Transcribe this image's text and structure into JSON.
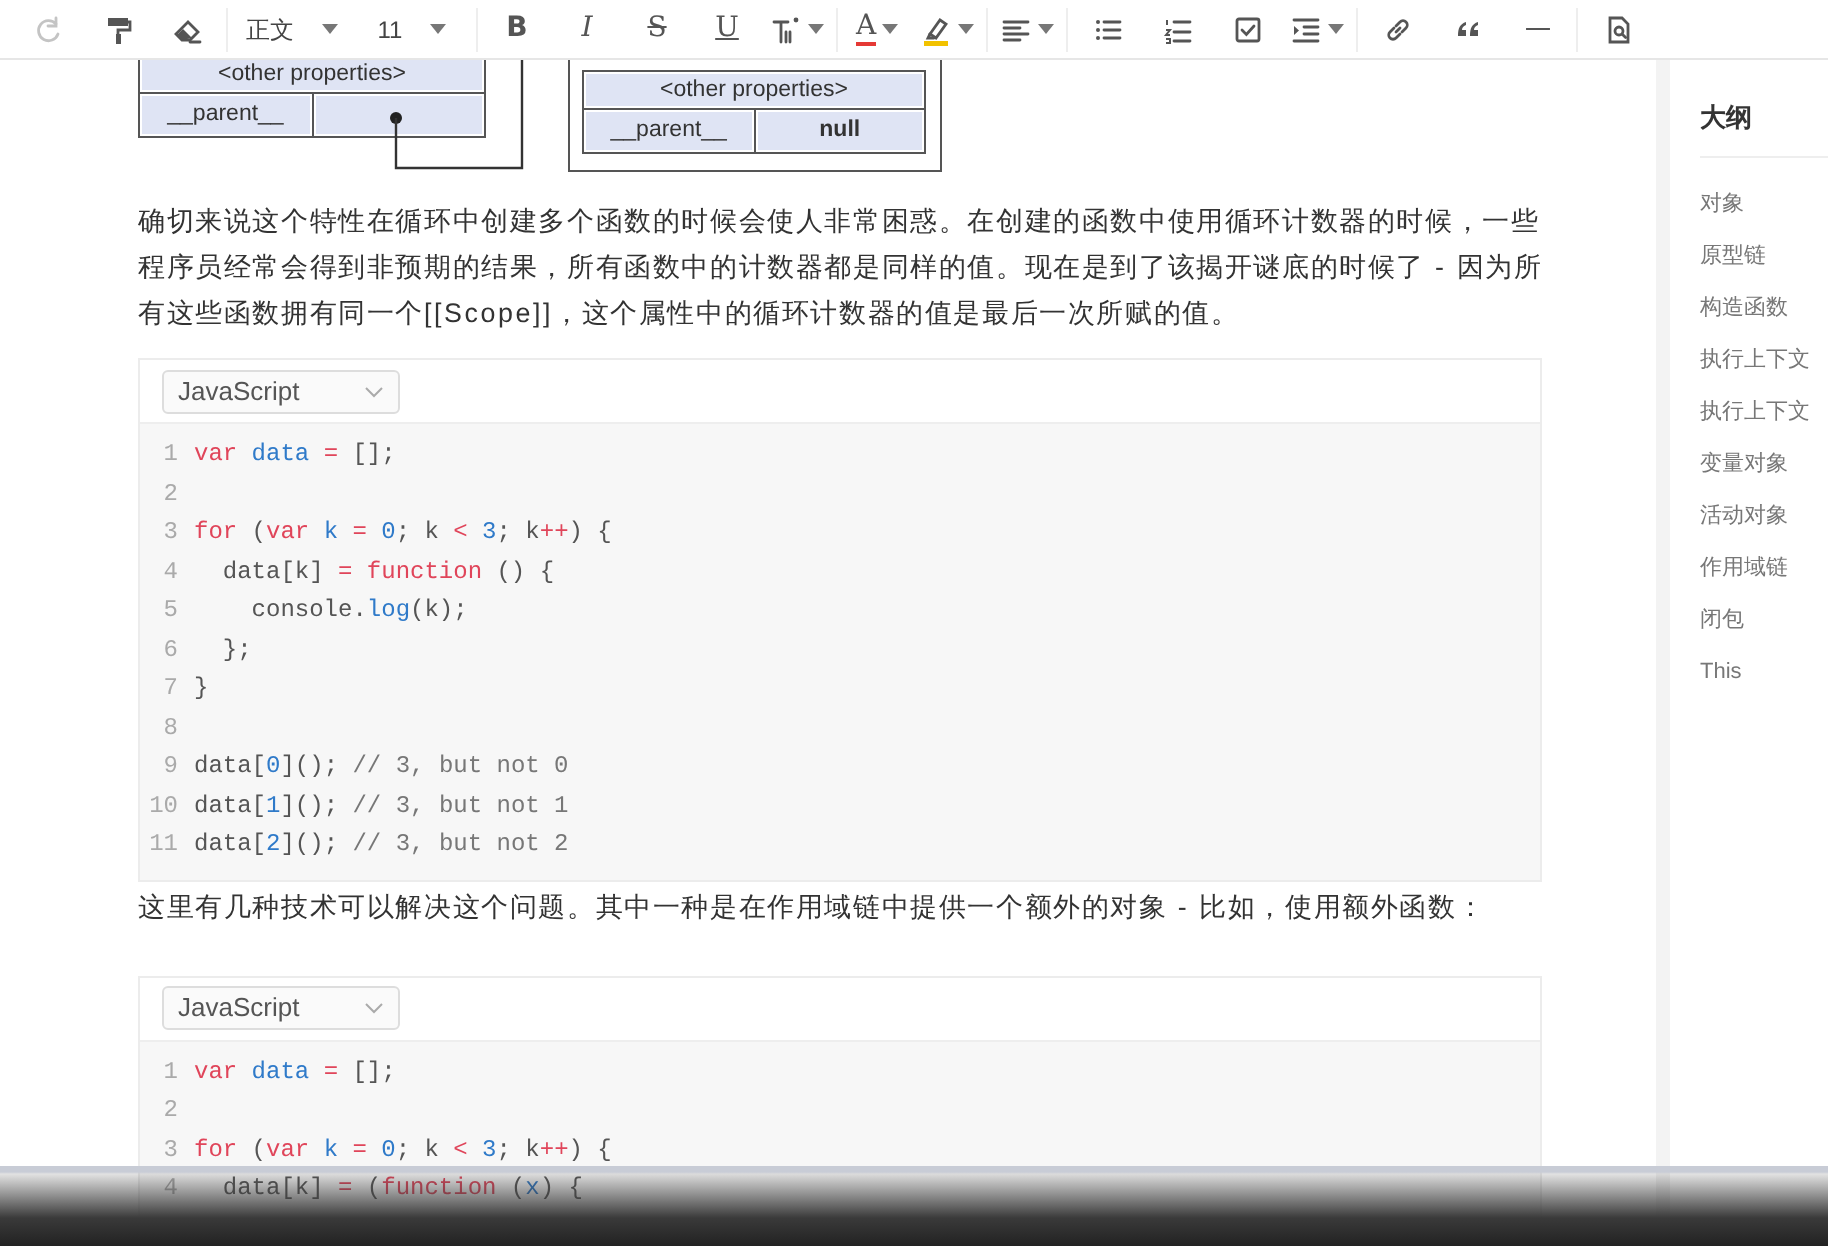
{
  "toolbar": {
    "redo": {
      "disabled": true
    },
    "selects": [
      "正文",
      "11"
    ],
    "format_letters": [
      "B",
      "I",
      "S",
      "U"
    ],
    "color_letter": "A"
  },
  "diagram": {
    "objects": [
      {
        "kind": "pointer",
        "properties_label": "<other properties>",
        "parent_label": "__parent__"
      },
      {
        "kind": "value",
        "properties_label": "<other properties>",
        "parent_label": "__parent__",
        "parent_value": "null"
      }
    ]
  },
  "content": [
    {
      "kind": "paragraph",
      "text": "确切来说这个特性在循环中创建多个函数的时候会使人非常困惑。在创建的函数中使用循环计数器的时候，一些程序员经常会得到非预期的结果，所有函数中的计数器都是同样的值。现在是到了该揭开谜底的时候了 - 因为所有这些函数拥有同一个[[Scope]]，这个属性中的循环计数器的值是最后一次所赋的值。"
    },
    {
      "kind": "code",
      "language": "JavaScript",
      "lines": [
        {
          "number": "1",
          "tokens": [
            {
              "t": "var",
              "kind": "keyword"
            },
            {
              "t": " data",
              "kind": "name"
            },
            {
              "t": " =",
              "kind": "operator"
            },
            {
              "t": " [];",
              "kind": "plain"
            }
          ]
        },
        {
          "number": "2"
        },
        {
          "number": "3",
          "tokens": [
            {
              "t": "for",
              "kind": "keyword"
            },
            {
              "t": " (",
              "kind": "plain"
            },
            {
              "t": "var",
              "kind": "keyword"
            },
            {
              "t": " k",
              "kind": "name"
            },
            {
              "t": " =",
              "kind": "operator"
            },
            {
              "t": " 0",
              "kind": "number"
            },
            {
              "t": "; k",
              "kind": "plain"
            },
            {
              "t": " <",
              "kind": "operator"
            },
            {
              "t": " 3",
              "kind": "number"
            },
            {
              "t": "; k",
              "kind": "plain"
            },
            {
              "t": "++",
              "kind": "operator"
            },
            {
              "t": ") {",
              "kind": "plain"
            }
          ]
        },
        {
          "number": "4",
          "tokens": [
            {
              "t": "  data[k]",
              "kind": "plain"
            },
            {
              "t": " =",
              "kind": "operator"
            },
            {
              "t": " function",
              "kind": "keyword"
            },
            {
              "t": " () {",
              "kind": "plain"
            }
          ]
        },
        {
          "number": "5",
          "tokens": [
            {
              "t": "    console.",
              "kind": "plain"
            },
            {
              "t": "log",
              "kind": "name"
            },
            {
              "t": "(k);",
              "kind": "plain"
            }
          ]
        },
        {
          "number": "6",
          "tokens": [
            {
              "t": "  };",
              "kind": "plain"
            }
          ]
        },
        {
          "number": "7",
          "tokens": [
            {
              "t": "}",
              "kind": "plain"
            }
          ]
        },
        {
          "number": "8"
        },
        {
          "number": "9",
          "tokens": [
            {
              "t": "data[",
              "kind": "plain"
            },
            {
              "t": "0",
              "kind": "number"
            },
            {
              "t": "]();",
              "kind": "plain"
            },
            {
              "t": " // 3, but not 0",
              "kind": "comment"
            }
          ]
        },
        {
          "number": "10",
          "tokens": [
            {
              "t": "data[",
              "kind": "plain"
            },
            {
              "t": "1",
              "kind": "number"
            },
            {
              "t": "]();",
              "kind": "plain"
            },
            {
              "t": " // 3, but not 1",
              "kind": "comment"
            }
          ]
        },
        {
          "number": "11",
          "tokens": [
            {
              "t": "data[",
              "kind": "plain"
            },
            {
              "t": "2",
              "kind": "number"
            },
            {
              "t": "]();",
              "kind": "plain"
            },
            {
              "t": " // 3, but not 2",
              "kind": "comment"
            }
          ]
        }
      ]
    },
    {
      "kind": "paragraph",
      "text": "这里有几种技术可以解决这个问题。其中一种是在作用域链中提供一个额外的对象 - 比如，使用额外函数："
    },
    {
      "kind": "code",
      "language": "JavaScript",
      "lines": [
        {
          "number": "1",
          "tokens": [
            {
              "t": "var",
              "kind": "keyword"
            },
            {
              "t": " data",
              "kind": "name"
            },
            {
              "t": " =",
              "kind": "operator"
            },
            {
              "t": " [];",
              "kind": "plain"
            }
          ]
        },
        {
          "number": "2"
        },
        {
          "number": "3",
          "tokens": [
            {
              "t": "for",
              "kind": "keyword"
            },
            {
              "t": " (",
              "kind": "plain"
            },
            {
              "t": "var",
              "kind": "keyword"
            },
            {
              "t": " k",
              "kind": "name"
            },
            {
              "t": " =",
              "kind": "operator"
            },
            {
              "t": " 0",
              "kind": "number"
            },
            {
              "t": "; k",
              "kind": "plain"
            },
            {
              "t": " <",
              "kind": "operator"
            },
            {
              "t": " 3",
              "kind": "number"
            },
            {
              "t": "; k",
              "kind": "plain"
            },
            {
              "t": "++",
              "kind": "operator"
            },
            {
              "t": ") {",
              "kind": "plain"
            }
          ]
        },
        {
          "number": "4",
          "tokens": [
            {
              "t": "  data[k]",
              "kind": "plain"
            },
            {
              "t": " =",
              "kind": "operator"
            },
            {
              "t": " (",
              "kind": "plain"
            },
            {
              "t": "function",
              "kind": "keyword"
            },
            {
              "t": " (",
              "kind": "plain"
            },
            {
              "t": "x",
              "kind": "name"
            },
            {
              "t": ") {",
              "kind": "plain"
            }
          ]
        }
      ]
    }
  ],
  "outline": {
    "title": "大纲",
    "items": [
      {
        "label": "对象"
      },
      {
        "label": "原型链"
      },
      {
        "label": "构造函数"
      },
      {
        "label": "执行上下文"
      },
      {
        "label": "执行上下文"
      },
      {
        "label": "变量对象"
      },
      {
        "label": "活动对象"
      },
      {
        "label": "作用域链"
      },
      {
        "label": "闭包"
      },
      {
        "label": "This"
      }
    ]
  }
}
